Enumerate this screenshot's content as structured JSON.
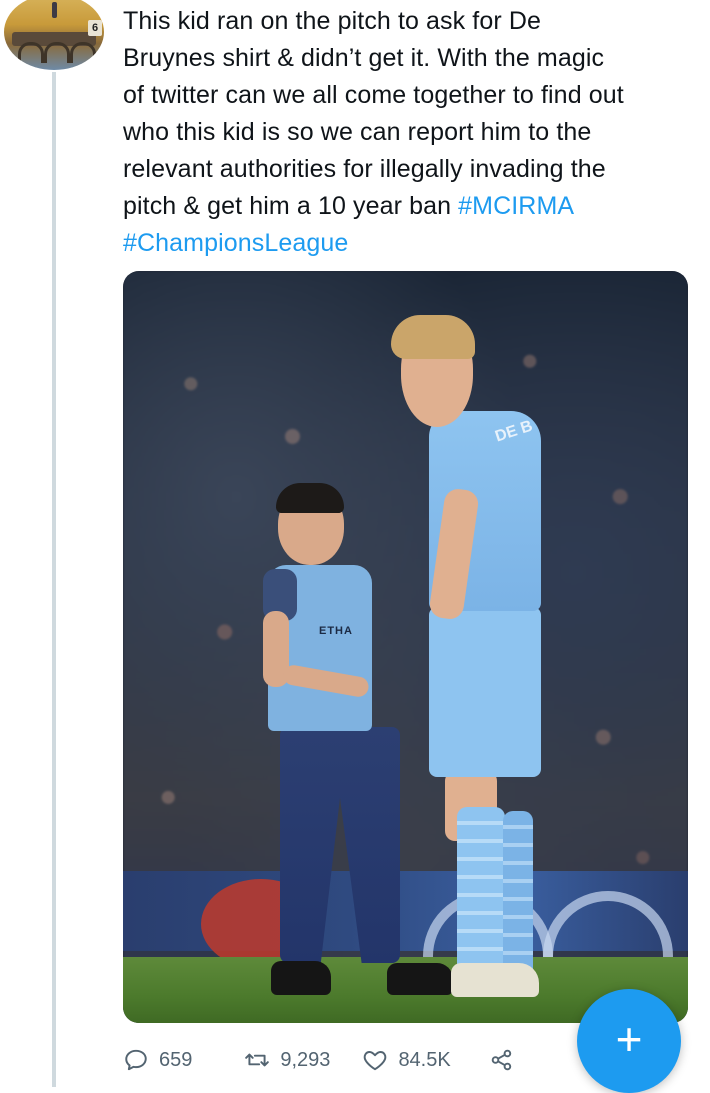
{
  "tweet": {
    "text_lines": [
      "This kid ran on the pitch to ask for De",
      "Bruynes shirt & didn’t get it. With the magic",
      "of twitter can we all come together to find out",
      "who this kid is so we can report him to the",
      "relevant authorities for illegally invading the",
      "pitch & get him a 10 year ban "
    ],
    "hashtags": [
      "#MCIRMA",
      "#ChampionsLeague"
    ]
  },
  "avatar": {
    "badge": "6"
  },
  "media": {
    "kid_sponsor": "ETHA",
    "player_name": "DE B"
  },
  "actions": {
    "reply_count": "659",
    "retweet_count": "9,293",
    "like_count": "84.5K"
  },
  "fab": {
    "glyph": "+"
  },
  "colors": {
    "link": "#1d9bf0",
    "text": "#0f1419",
    "muted": "#536471",
    "thread_line": "#cfd9de"
  }
}
